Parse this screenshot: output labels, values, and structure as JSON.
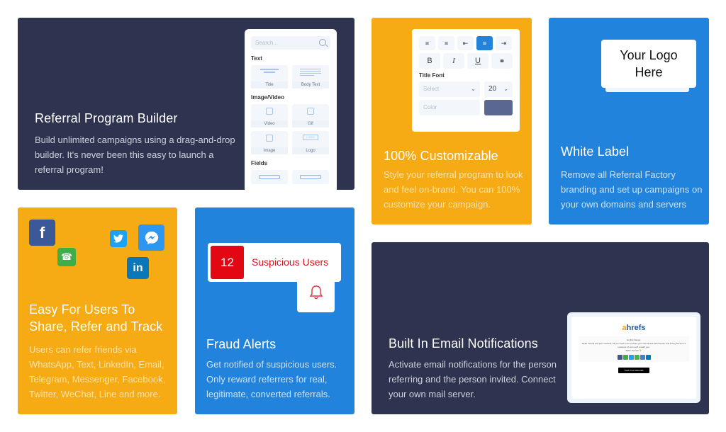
{
  "colors": {
    "navy": "#2e3450",
    "orange": "#f6aa14",
    "blue": "#2283dc",
    "alert_red": "#e30613"
  },
  "cards": {
    "builder": {
      "title": "Referral Program Builder",
      "description": "Build unlimited campaigns using a drag-and-drop builder. It's never been this easy to launch a referral program!",
      "panel": {
        "search_placeholder": "Search...",
        "sections": {
          "text": "Text",
          "image_video": "Image/Video",
          "fields": "Fields"
        },
        "tiles": {
          "title": "Title",
          "body_text": "Body Text",
          "video": "Video",
          "gif": "Gif",
          "image": "Image",
          "logo": "Logo",
          "logo_glyph": "LOGO"
        }
      }
    },
    "custom": {
      "title": "100% Customizable",
      "description": "Style your referral program to look and feel on-brand. You can 100% customize your campaign.",
      "panel": {
        "align_buttons": [
          "align-left",
          "justify",
          "align-left-short",
          "align-center",
          "align-right"
        ],
        "active_align": "align-center",
        "format_buttons": {
          "bold": "B",
          "italic": "I",
          "underline": "U",
          "link": "⚭"
        },
        "title_font_label": "Title Font",
        "font_select_placeholder": "Select",
        "font_size": "20",
        "color_placeholder": "Color",
        "color_value": "#5a6791"
      }
    },
    "white_label": {
      "title": "White Label",
      "description": "Remove all Referral Factory branding and set up campaigns on your own domains and servers",
      "logo_placeholder_line1": "Your Logo",
      "logo_placeholder_line2": "Here"
    },
    "share": {
      "title": "Easy For Users To Share, Refer and Track",
      "description": "Users can refer friends via WhatsApp, Text, LinkedIn, Email, Telegram, Messenger, Facebook, Twitter, WeChat, Line and more.",
      "icons": {
        "facebook": "f",
        "whatsapp": "☎",
        "twitter": "🐦",
        "messenger": "↯",
        "linkedin": "in"
      }
    },
    "fraud": {
      "title": "Fraud Alerts",
      "description": "Get notified of suspicious users. Only reward referrers for real, legitimate, converted referrals.",
      "suspicious_count": "12",
      "suspicious_label": "Suspicious Users"
    },
    "email": {
      "title": "Built In Email Notifications",
      "description": "Activate email notifications for the person referring and the person invited. Connect your own mail server.",
      "preview": {
        "brand_first": "a",
        "brand_rest": "hrefs",
        "greeting": "Hi {first Name},",
        "body": "Refer friends and earn rewards. All you need to do is share your referral link with friends, and if they become a customer of ours we'll reward you.",
        "refer_label": "Refer Friends 👇",
        "button_label": "Track Your Referrals"
      }
    }
  }
}
